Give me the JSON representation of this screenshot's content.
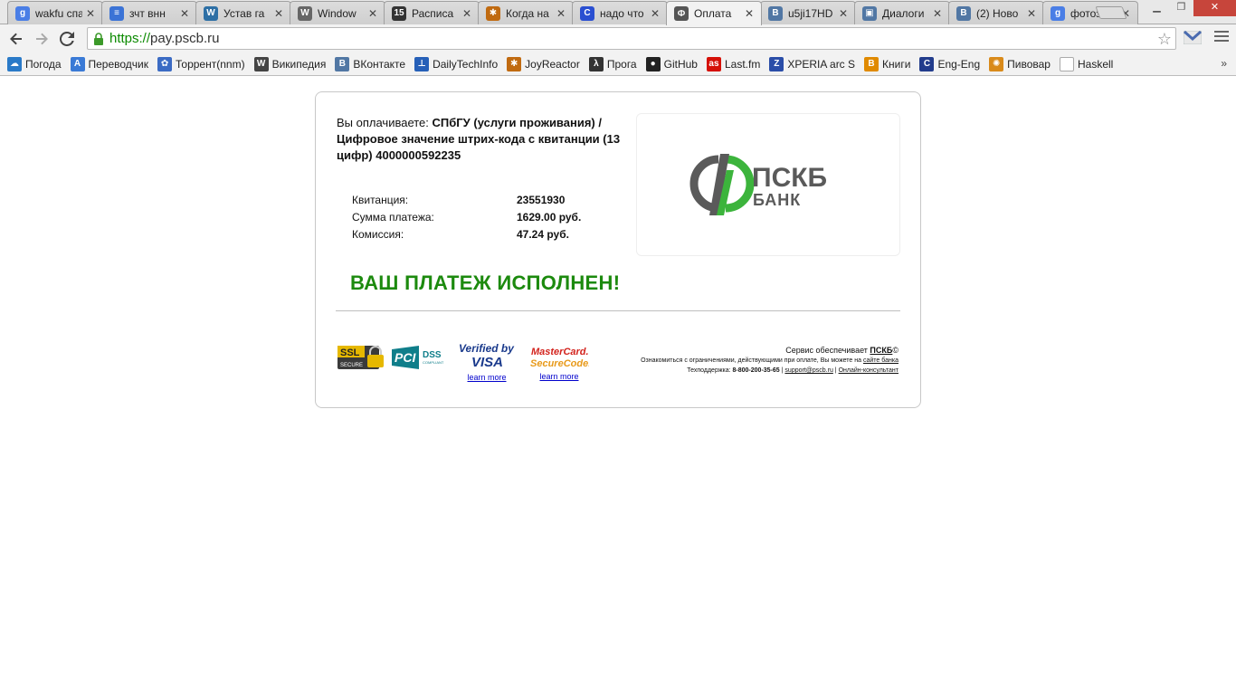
{
  "browser": {
    "tabs": [
      {
        "title": "wakfu спа",
        "favicon": "google-icon",
        "color": "#4a7ee6",
        "letter": "g"
      },
      {
        "title": "зчт внн",
        "favicon": "docs-icon",
        "color": "#3b73d6",
        "letter": "≡"
      },
      {
        "title": "Устав га",
        "favicon": "wordpress-icon",
        "color": "#2d6fa5",
        "letter": "W"
      },
      {
        "title": "Window",
        "favicon": "wordpress-icon",
        "color": "#666666",
        "letter": "W"
      },
      {
        "title": "Расписа",
        "favicon": "calendar-icon",
        "color": "#333333",
        "letter": "15"
      },
      {
        "title": "Когда на",
        "favicon": "joyreactor-icon",
        "color": "#c06a10",
        "letter": "✱"
      },
      {
        "title": "надо что",
        "favicon": "c-icon",
        "color": "#2a4fd1",
        "letter": "C"
      },
      {
        "title": "Оплата",
        "favicon": "pscb-icon",
        "color": "#555555",
        "letter": "Ф",
        "active": true
      },
      {
        "title": "u5ji17HD",
        "favicon": "vk-icon",
        "color": "#5177a4",
        "letter": "B"
      },
      {
        "title": "Диалоги",
        "favicon": "vk-dialog-icon",
        "color": "#5177a4",
        "letter": "▣"
      },
      {
        "title": "(2) Ново",
        "favicon": "vk-icon",
        "color": "#5177a4",
        "letter": "B"
      },
      {
        "title": "фотози",
        "favicon": "google-icon",
        "color": "#4a7ee6",
        "letter": "g"
      }
    ],
    "close_glyph": "✕",
    "url_scheme": "https://",
    "url_host": "pay.pscb.ru",
    "bookmarks": [
      {
        "label": "Погода",
        "icon": "weather-icon",
        "color": "#2a7ac8",
        "letter": "☁"
      },
      {
        "label": "Переводчик",
        "icon": "translate-icon",
        "color": "#3a7ad6",
        "letter": "A"
      },
      {
        "label": "Торрент(nnm)",
        "icon": "butterfly-icon",
        "color": "#3b6bc4",
        "letter": "✿"
      },
      {
        "label": "Википедия",
        "icon": "wikipedia-icon",
        "color": "#444444",
        "letter": "W"
      },
      {
        "label": "ВКонтакте",
        "icon": "vk-icon",
        "color": "#5177a4",
        "letter": "B"
      },
      {
        "label": "DailyTechInfo",
        "icon": "dti-icon",
        "color": "#2660b8",
        "letter": "⊥"
      },
      {
        "label": "JoyReactor",
        "icon": "joyreactor-icon",
        "color": "#c06a10",
        "letter": "✱"
      },
      {
        "label": "Прога",
        "icon": "lambda-icon",
        "color": "#333333",
        "letter": "λ"
      },
      {
        "label": "GitHub",
        "icon": "github-icon",
        "color": "#222222",
        "letter": "●"
      },
      {
        "label": "Last.fm",
        "icon": "lastfm-icon",
        "color": "#d51007",
        "letter": "as"
      },
      {
        "label": "XPERIA arc S",
        "icon": "xperia-icon",
        "color": "#2a4da8",
        "letter": "Z"
      },
      {
        "label": "Книги",
        "icon": "books-icon",
        "color": "#e08a00",
        "letter": "B"
      },
      {
        "label": "Eng-Eng",
        "icon": "dictionary-icon",
        "color": "#223c8c",
        "letter": "C"
      },
      {
        "label": "Пивовар",
        "icon": "beer-icon",
        "color": "#d98a1a",
        "letter": "✺"
      },
      {
        "label": "Haskell",
        "icon": "page-icon",
        "color": "#bbbbbb",
        "letter": ""
      }
    ],
    "bookmarks_more": "»"
  },
  "page": {
    "paying_label": "Вы оплачиваете:",
    "paying_value": "СПбГУ (услуги проживания) / Цифровое значение штрих-кода с квитанции (13 цифр) 4000000592235",
    "rows": [
      {
        "label": "Квитанция:",
        "value": "23551930"
      },
      {
        "label": "Сумма платежа:",
        "value": "1629.00 руб."
      },
      {
        "label": "Комиссия:",
        "value": "47.24 руб."
      }
    ],
    "logo_top": "ПСКБ",
    "logo_bottom": "БАНК",
    "success": "ВАШ ПЛАТЕЖ ИСПОЛНЕН!",
    "badges": {
      "ssl_top": "SSL",
      "ssl_bottom": "SECURE",
      "pci": "PCI",
      "dss": "DSS",
      "compliant": "COMPLIANT",
      "verified_line1": "Verified by",
      "verified_line2": "VISA",
      "visa_learn": "learn more",
      "mc_line1": "MasterCard.",
      "mc_line2": "SecureCode.",
      "mc_learn": "learn more"
    },
    "footer": {
      "service_prefix": "Сервис обеспечивает",
      "service_brand": "ПСКБ",
      "service_suffix": "©",
      "limits_text": "Ознакомиться с ограничениями, действующими при оплате, Вы можете на",
      "limits_link": "сайте банка",
      "support_label": "Техподдержка:",
      "support_phone": "8-800-200-35-65",
      "sep": "|",
      "support_email": "support@pscb.ru",
      "online": "Онлайн-консультант"
    }
  },
  "colors": {
    "success_green": "#1c8a0e",
    "logo_gray": "#5a5a5a",
    "logo_green": "#3cb43c",
    "link_blue": "#0000cc"
  }
}
